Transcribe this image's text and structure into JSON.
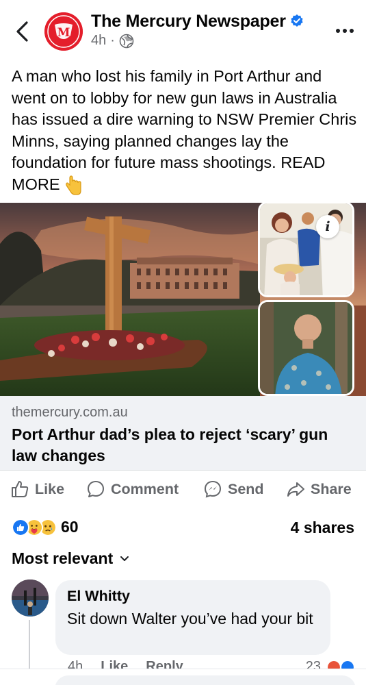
{
  "header": {
    "page_name": "The Mercury Newspaper",
    "time": "4h",
    "separator": "·",
    "logo_letter": "M",
    "colors": {
      "brand_red": "#e41e2b",
      "verified_blue": "#1877f2"
    }
  },
  "post": {
    "text": "A man who lost his family in Port Arthur and went on to lobby for new gun laws in Australia has issued a dire warning to NSW Premier Chris Minns, saying planned changes lay the foundation for future mass shootings. READ MORE",
    "emoji": "pointing-down-hand"
  },
  "link_preview": {
    "domain": "themercury.com.au",
    "title": "Port Arthur dad’s plea to reject ‘scary’ gun law changes",
    "info_label": "i"
  },
  "actions": {
    "like": "Like",
    "comment": "Comment",
    "send": "Send",
    "share": "Share"
  },
  "stats": {
    "reaction_count": "60",
    "shares": "4 shares",
    "reaction_icons": [
      "like",
      "care",
      "sad"
    ]
  },
  "comments_section": {
    "sort_label": "Most relevant",
    "comments": [
      {
        "author": "El Whitty",
        "text": "Sit down Walter you’ve had your bit",
        "time": "4h",
        "like_label": "Like",
        "reply_label": "Reply",
        "reaction_count": "23"
      }
    ]
  }
}
